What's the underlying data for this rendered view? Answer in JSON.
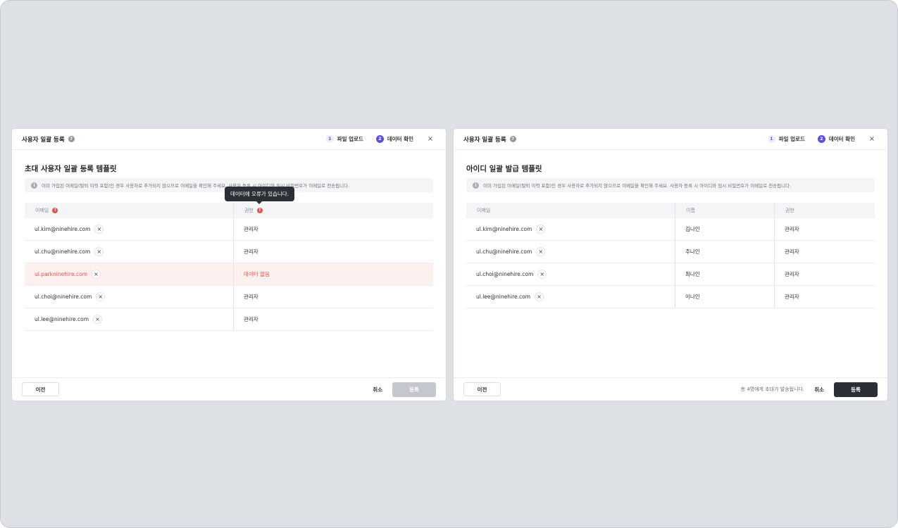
{
  "left_modal": {
    "title": "사용자 일괄 등록",
    "help_icon": "?",
    "steps": [
      {
        "num": "1",
        "label": "파일 업로드",
        "state": "inactive"
      },
      {
        "num": "2",
        "label": "데이터 확인",
        "state": "active"
      }
    ],
    "close_icon": "×",
    "body_title": "초대 사용자 일괄 등록 템플릿",
    "notice_icon": "i",
    "notice": "이미 가입된 이메일(탈퇴 이력 포함)인 경우 사용자로 추가되지 않으므로 이메일을 확인해 주세요. 사용자 등록 시 아이디와 임시 비밀번호가 이메일로 전송됩니다.",
    "tooltip": "데이터에 오류가 있습니다.",
    "columns": [
      "이메일",
      "권한"
    ],
    "error_icon": "!",
    "rows": [
      {
        "email": "ul.kim@ninehire.com",
        "role": "관리자",
        "error": false
      },
      {
        "email": "ul.chu@ninehire.com",
        "role": "관리자",
        "error": false
      },
      {
        "email": "ul.parkninehire.com",
        "role": "데이터 없음",
        "error": true
      },
      {
        "email": "ul.choi@ninehire.com",
        "role": "관리자",
        "error": false
      },
      {
        "email": "ul.lee@ninehire.com",
        "role": "관리자",
        "error": false
      }
    ],
    "remove_icon": "×",
    "footer": {
      "prev": "이전",
      "cancel": "취소",
      "submit": "등록"
    }
  },
  "right_modal": {
    "title": "사용자 일괄 등록",
    "help_icon": "?",
    "steps": [
      {
        "num": "1",
        "label": "파일 업로드",
        "state": "inactive"
      },
      {
        "num": "2",
        "label": "데이터 확인",
        "state": "active"
      }
    ],
    "close_icon": "×",
    "body_title": "아이디 일괄 발급 템플릿",
    "notice_icon": "i",
    "notice": "이미 가입된 이메일(탈퇴 이력 포함)인 경우 사용자로 추가되지 않으므로 이메일을 확인해 주세요. 사용자 등록 시 아이디와 임시 비밀번호가 이메일로 전송됩니다.",
    "columns": [
      "이메일",
      "이름",
      "권한"
    ],
    "rows": [
      {
        "email": "ul.kim@ninehire.com",
        "name": "김나인",
        "role": "관리자"
      },
      {
        "email": "ul.chu@ninehire.com",
        "name": "추나인",
        "role": "관리자"
      },
      {
        "email": "ul.choi@ninehire.com",
        "name": "최나인",
        "role": "관리자"
      },
      {
        "email": "ul.lee@ninehire.com",
        "name": "이나인",
        "role": "관리자"
      }
    ],
    "remove_icon": "×",
    "footer": {
      "prev": "이전",
      "note": "총 4명에게 초대가 발송됩니다.",
      "cancel": "취소",
      "submit": "등록"
    }
  },
  "colors": {
    "accent": "#5b4fe6",
    "error": "#e5554a",
    "dark": "#2b2f36",
    "disabled": "#c4c7cd"
  }
}
